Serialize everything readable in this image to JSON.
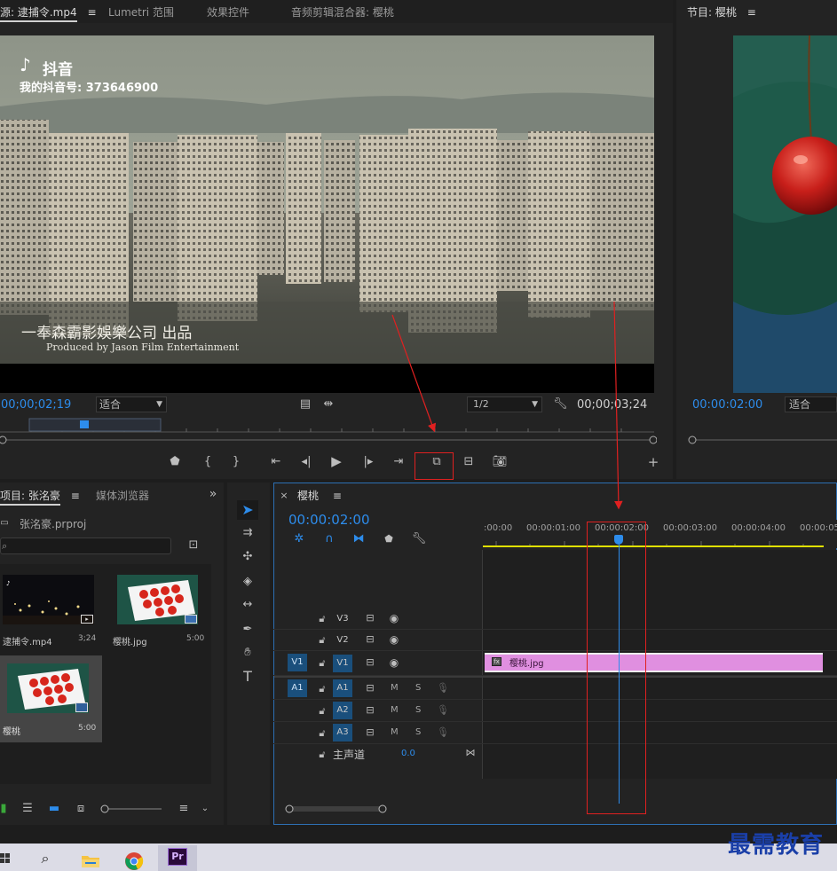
{
  "source_monitor": {
    "tabs": [
      "源: 逮捕令.mp4",
      "Lumetri 范围",
      "效果控件",
      "音频剪辑混合器: 樱桃"
    ],
    "tab_menu": "≡",
    "video_watermark_brand": "抖音",
    "video_watermark_id": "我的抖音号: 373646900",
    "video_caption_cn": "一奉森霸影娛樂公司 出品",
    "video_caption_en": "Produced by Jason Film Entertainment",
    "timecode": "00;00;02;19",
    "fit": "适合",
    "resolution": "1/2",
    "duration": "00;00;03;24"
  },
  "program_monitor": {
    "title": "节目: 樱桃",
    "tab_menu": "≡",
    "timecode": "00:00:02:00",
    "fit": "适合"
  },
  "project": {
    "tabs": [
      "项目: 张洺豪",
      "媒体浏览器"
    ],
    "tab_menu": "≡",
    "more": "»",
    "project_file": "张洺豪.prproj",
    "items": [
      {
        "name": "逮捕令.mp4",
        "duration": "3;24"
      },
      {
        "name": "樱桃.jpg",
        "duration": "5:00"
      },
      {
        "name": "樱桃",
        "duration": "5:00"
      }
    ]
  },
  "timeline": {
    "close": "×",
    "title": "樱桃",
    "tab_menu": "≡",
    "timecode": "00:00:02:00",
    "ruler": [
      ":00:00",
      "00:00:01:00",
      "00:00:02:00",
      "00:00:03:00",
      "00:00:04:00",
      "00:00:05"
    ],
    "video_tracks": [
      "V3",
      "V2",
      "V1"
    ],
    "audio_tracks": [
      "A1",
      "A2",
      "A3"
    ],
    "source_v": "V1",
    "source_a": "A1",
    "mute": "M",
    "solo": "S",
    "master_label": "主声道",
    "master_value": "0.0",
    "clip_name": "樱桃.jpg"
  },
  "taskbar": {
    "premiere": "Pr"
  },
  "watermark": "最需教育",
  "colors": {
    "accent": "#2d8ceb",
    "clip": "#e08fe0",
    "annotation": "#e02020",
    "work_area": "#e0e000"
  }
}
